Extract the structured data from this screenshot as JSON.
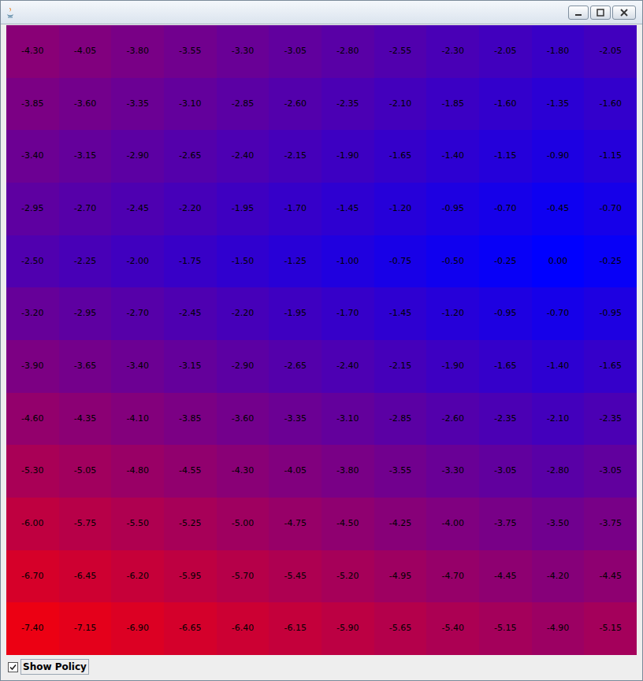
{
  "window": {
    "title": ""
  },
  "grid": {
    "rows": [
      [
        "-4.30",
        "-4.05",
        "-3.80",
        "-3.55",
        "-3.30",
        "-3.05",
        "-2.80",
        "-2.55",
        "-2.30",
        "-2.05",
        "-1.80",
        "-2.05"
      ],
      [
        "-3.85",
        "-3.60",
        "-3.35",
        "-3.10",
        "-2.85",
        "-2.60",
        "-2.35",
        "-2.10",
        "-1.85",
        "-1.60",
        "-1.35",
        "-1.60"
      ],
      [
        "-3.40",
        "-3.15",
        "-2.90",
        "-2.65",
        "-2.40",
        "-2.15",
        "-1.90",
        "-1.65",
        "-1.40",
        "-1.15",
        "-0.90",
        "-1.15"
      ],
      [
        "-2.95",
        "-2.70",
        "-2.45",
        "-2.20",
        "-1.95",
        "-1.70",
        "-1.45",
        "-1.20",
        "-0.95",
        "-0.70",
        "-0.45",
        "-0.70"
      ],
      [
        "-2.50",
        "-2.25",
        "-2.00",
        "-1.75",
        "-1.50",
        "-1.25",
        "-1.00",
        "-0.75",
        "-0.50",
        "-0.25",
        "0.00",
        "-0.25"
      ],
      [
        "-3.20",
        "-2.95",
        "-2.70",
        "-2.45",
        "-2.20",
        "-1.95",
        "-1.70",
        "-1.45",
        "-1.20",
        "-0.95",
        "-0.70",
        "-0.95"
      ],
      [
        "-3.90",
        "-3.65",
        "-3.40",
        "-3.15",
        "-2.90",
        "-2.65",
        "-2.40",
        "-2.15",
        "-1.90",
        "-1.65",
        "-1.40",
        "-1.65"
      ],
      [
        "-4.60",
        "-4.35",
        "-4.10",
        "-3.85",
        "-3.60",
        "-3.35",
        "-3.10",
        "-2.85",
        "-2.60",
        "-2.35",
        "-2.10",
        "-2.35"
      ],
      [
        "-5.30",
        "-5.05",
        "-4.80",
        "-4.55",
        "-4.30",
        "-4.05",
        "-3.80",
        "-3.55",
        "-3.30",
        "-3.05",
        "-2.80",
        "-3.05"
      ],
      [
        "-6.00",
        "-5.75",
        "-5.50",
        "-5.25",
        "-5.00",
        "-4.75",
        "-4.50",
        "-4.25",
        "-4.00",
        "-3.75",
        "-3.50",
        "-3.75"
      ],
      [
        "-6.70",
        "-6.45",
        "-6.20",
        "-5.95",
        "-5.70",
        "-5.45",
        "-5.20",
        "-4.95",
        "-4.70",
        "-4.45",
        "-4.20",
        "-4.45"
      ],
      [
        "-7.40",
        "-7.15",
        "-6.90",
        "-6.65",
        "-6.40",
        "-6.15",
        "-5.90",
        "-5.65",
        "-5.40",
        "-5.15",
        "-4.90",
        "-5.15"
      ]
    ]
  },
  "checkbox": {
    "label": "Show Policy",
    "checked": true
  }
}
